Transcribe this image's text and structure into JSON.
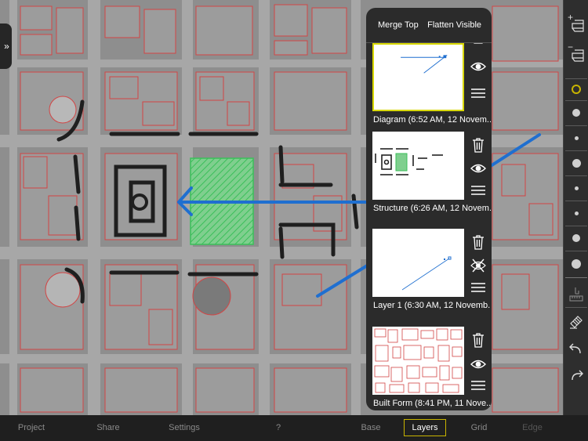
{
  "panel": {
    "merge_top": "Merge Top",
    "flatten_visible": "Flatten Visible",
    "layers": [
      {
        "name": "Diagram (6:52 AM, 12 Novem...",
        "visible": true,
        "selected": true
      },
      {
        "name": "Structure (6:26 AM, 12 Novem...",
        "visible": true,
        "selected": false
      },
      {
        "name": "Layer 1 (6:30 AM, 12 Novemb...",
        "visible": false,
        "selected": false
      },
      {
        "name": "Built Form (8:41 PM, 11 Nove...",
        "visible": true,
        "selected": false
      }
    ]
  },
  "sidebar": {
    "collapse_glyph": "»"
  },
  "bottom_bar": {
    "tabs": [
      {
        "label": "Project"
      },
      {
        "label": "Share"
      },
      {
        "label": "Settings"
      },
      {
        "label": "?"
      },
      {
        "label": "Base"
      },
      {
        "label": "Layers",
        "active": true
      },
      {
        "label": "Grid"
      },
      {
        "label": "Edge",
        "disabled": true
      }
    ]
  },
  "right_toolbar": {
    "add_layer_label": "+",
    "remove_layer_label": "−",
    "selected_brush_color": "#c8b400",
    "brush_sizes": [
      "xs",
      "s",
      "m",
      "l",
      "m2",
      "s2",
      "l2",
      "xl"
    ],
    "tools": [
      "ruler-icon",
      "eraser-icon",
      "undo-icon",
      "redo-icon"
    ]
  },
  "colors": {
    "accent": "#c8b400",
    "stroke_blue": "#1f6fd0",
    "parcel_red": "#d24545",
    "hatch_green": "#3bbf5a"
  }
}
